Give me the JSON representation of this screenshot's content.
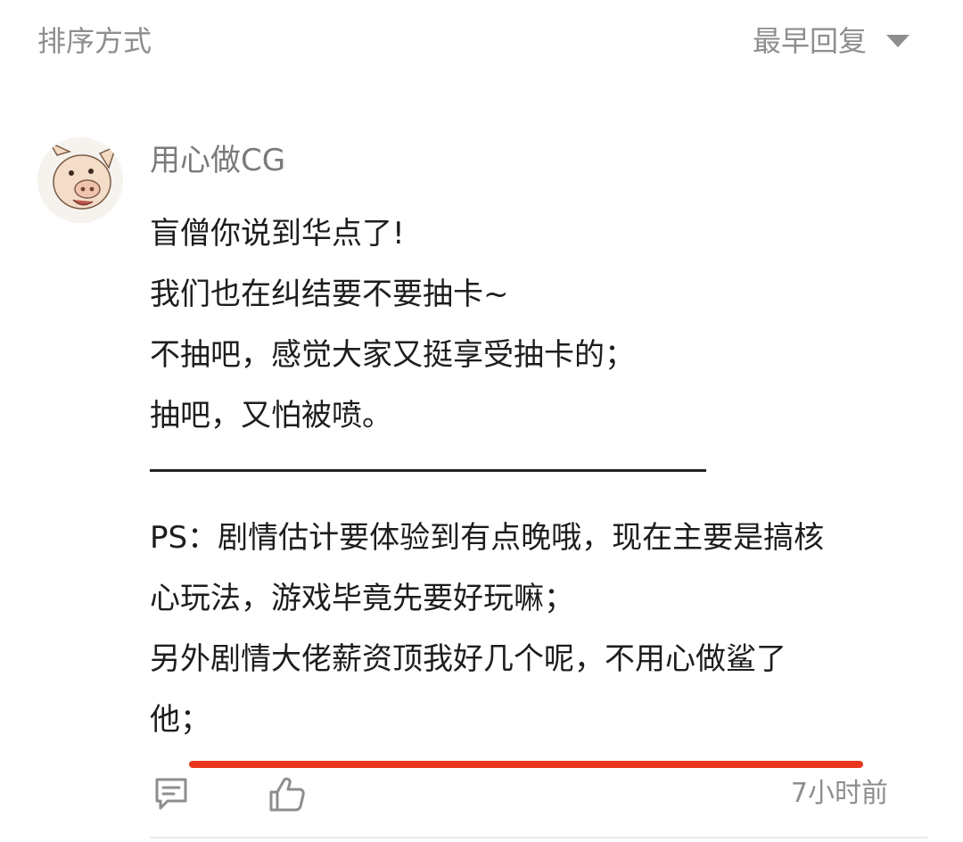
{
  "sort": {
    "label": "排序方式",
    "selected": "最早回复",
    "caret_icon": "triangle-down-icon"
  },
  "comment": {
    "author": "用心做CG",
    "avatar_icon": "pig-avatar",
    "lines": [
      "盲僧你说到华点了!",
      "我们也在纠结要不要抽卡~",
      "不抽吧，感觉大家又挺享受抽卡的；",
      "抽吧，又怕被喷。"
    ],
    "ps_lines": [
      "PS：剧情估计要体验到有点晚哦，现在主要是搞核",
      "心玩法，游戏毕竟先要好玩嘛；",
      "另外剧情大佬薪资顶我好几个呢，不用心做鲨了",
      "他；"
    ],
    "time": "7小时前",
    "actions": {
      "reply_icon": "comment-icon",
      "like_icon": "thumbs-up-icon"
    },
    "highlight_color": "#e8361e"
  }
}
